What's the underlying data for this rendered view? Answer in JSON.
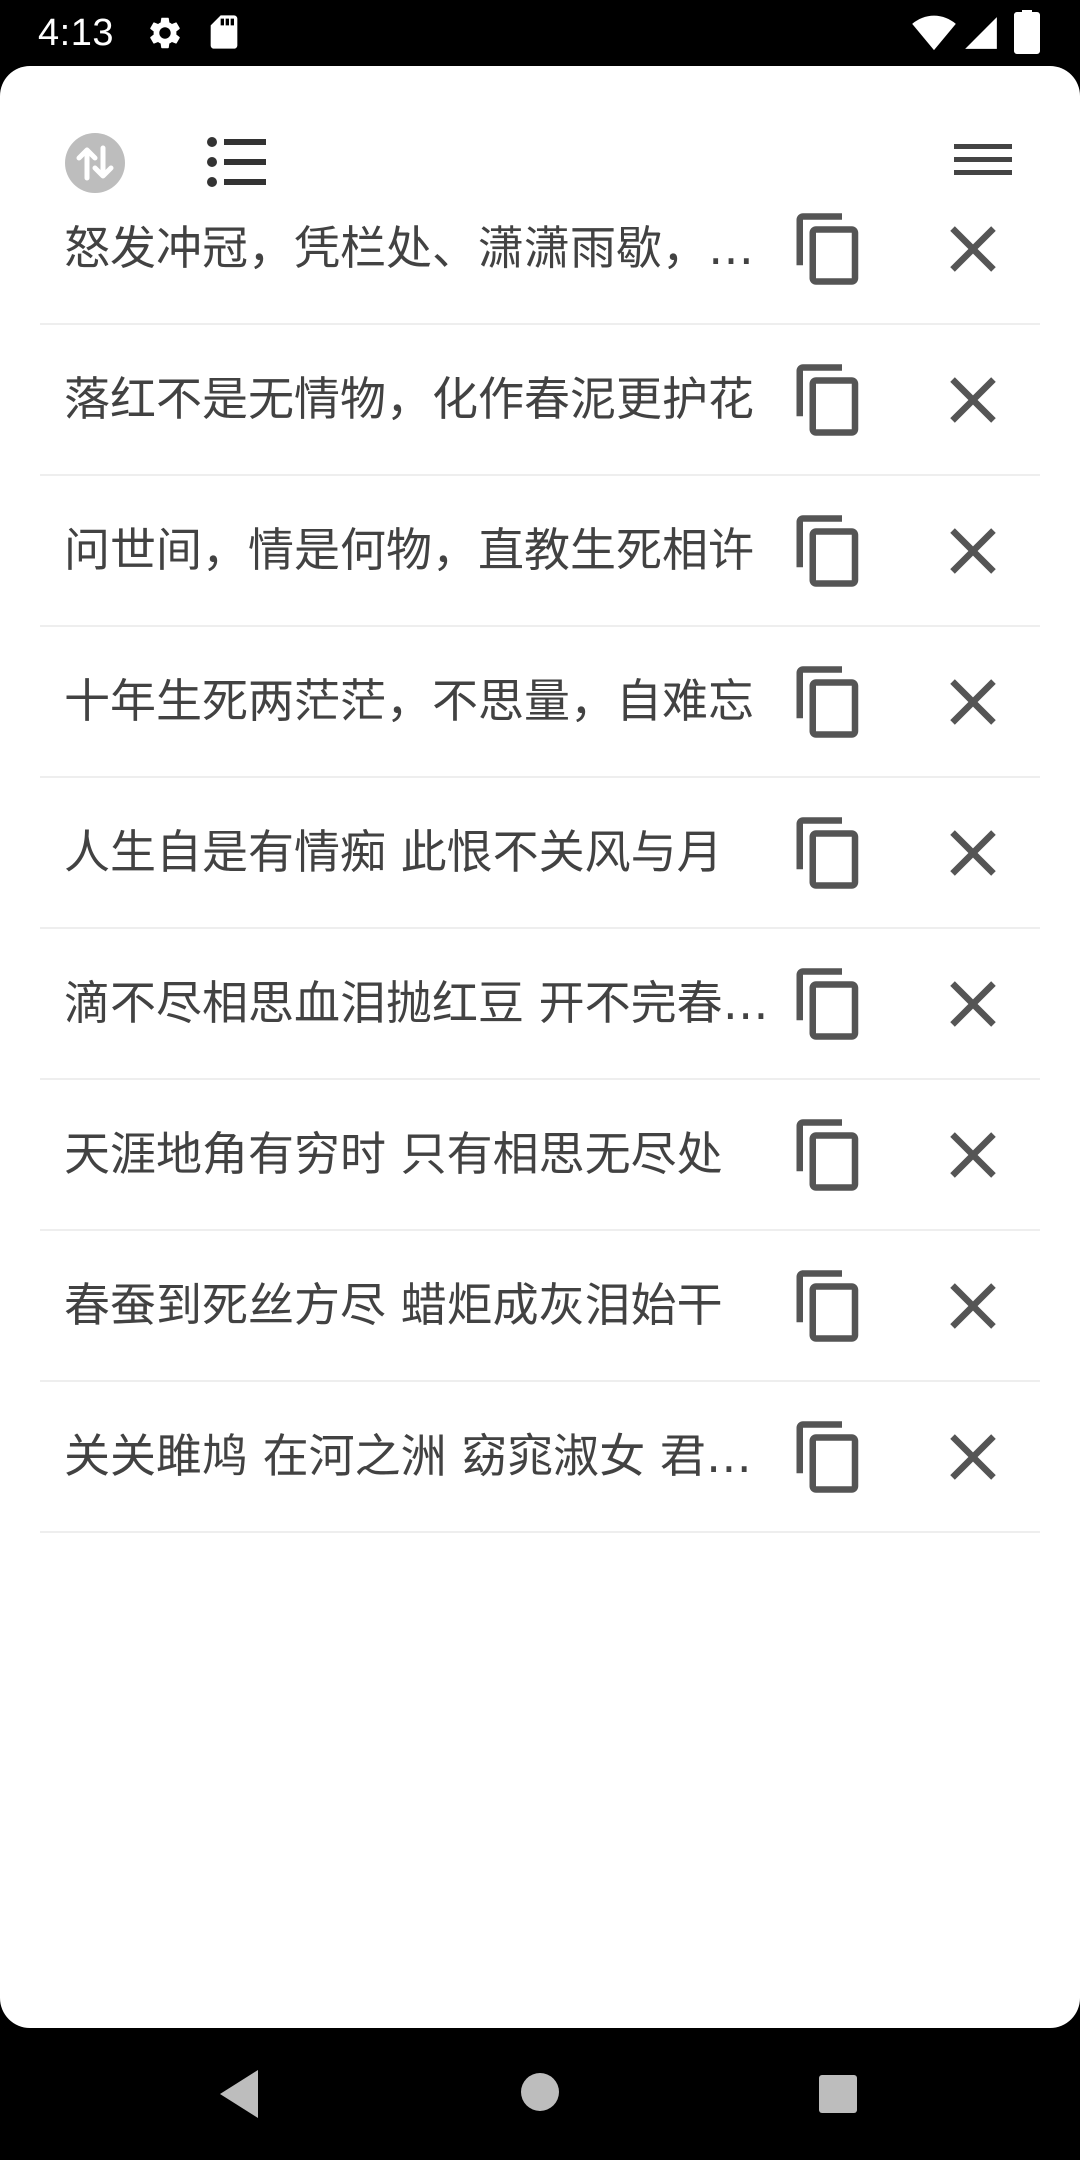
{
  "status_bar": {
    "time": "4:13",
    "icons": [
      "gear-icon",
      "sd-card-icon",
      "wifi-icon",
      "signal-icon",
      "battery-icon"
    ]
  },
  "toolbar": {
    "left_icons": [
      "swap-vertical-icon",
      "list-icon"
    ],
    "right_icons": [
      "menu-icon"
    ]
  },
  "items": [
    {
      "text": "怒发冲冠，凭栏处、潇潇雨歇，抬望眼、仰天长啸"
    },
    {
      "text": "落红不是无情物，化作春泥更护花"
    },
    {
      "text": "问世间，情是何物，直教生死相许"
    },
    {
      "text": "十年生死两茫茫，不思量，自难忘"
    },
    {
      "text": "人生自是有情痴 此恨不关风与月"
    },
    {
      "text": "滴不尽相思血泪抛红豆 开不完春柳春花满画楼"
    },
    {
      "text": "天涯地角有穷时 只有相思无尽处"
    },
    {
      "text": "春蚕到死丝方尽 蜡炬成灰泪始干"
    },
    {
      "text": "关关雎鸠 在河之洲 窈窕淑女 君子好逑"
    }
  ],
  "row_icons": {
    "copy": "copy-icon",
    "delete": "close-icon"
  },
  "nav_bar": {
    "icons": [
      "back-icon",
      "home-icon",
      "recents-icon"
    ]
  },
  "colors": {
    "text": "#424242",
    "icon": "#555555",
    "divider": "#eeeeee",
    "swap_button_bg": "#bdbdbd"
  }
}
